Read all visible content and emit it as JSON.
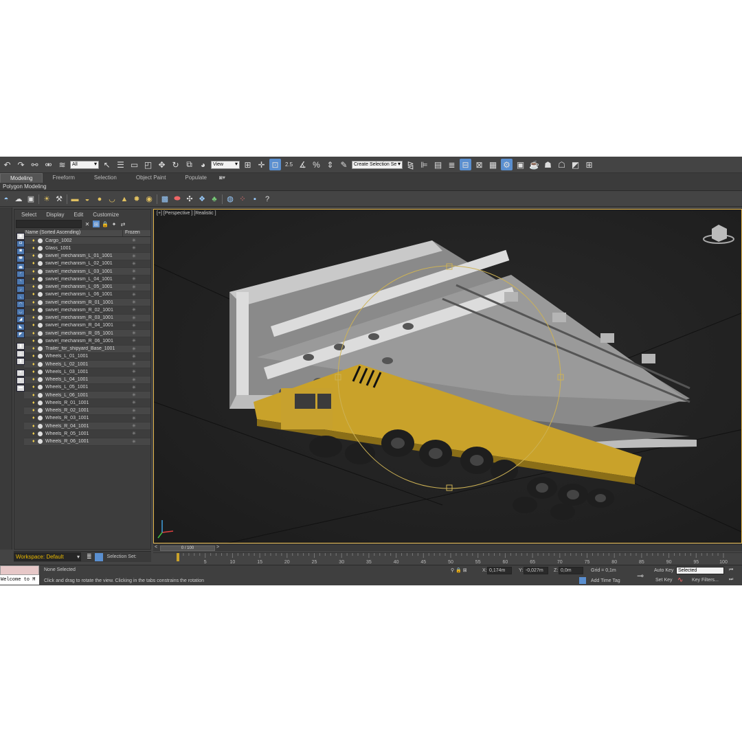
{
  "toolbar": {
    "selection_filter": "All",
    "ref_coord": "View",
    "snap_angle": "2.5",
    "named_selection": "Create Selection Se"
  },
  "ribbon": {
    "tabs": [
      "Modeling",
      "Freeform",
      "Selection",
      "Object Paint",
      "Populate"
    ],
    "active_tab": "Modeling",
    "panel": "Polygon Modeling"
  },
  "scene_explorer": {
    "menu": [
      "Select",
      "Display",
      "Edit",
      "Customize"
    ],
    "col_name": "Name (Sorted Ascending)",
    "col_frozen": "Frozen",
    "objects": [
      "Cargo_1002",
      "Glass_1001",
      "swivel_mechanism_L_01_1001",
      "swivel_mechanism_L_02_1001",
      "swivel_mechanism_L_03_1001",
      "swivel_mechanism_L_04_1001",
      "swivel_mechanism_L_05_1001",
      "swivel_mechanism_L_06_1001",
      "swivel_mechanism_R_01_1001",
      "swivel_mechanism_R_02_1001",
      "swivel_mechanism_R_03_1001",
      "swivel_mechanism_R_04_1001",
      "swivel_mechanism_R_05_1001",
      "swivel_mechanism_R_06_1001",
      "Trailer_for_shipyard_Base_1001",
      "Wheels_L_01_1001",
      "Wheels_L_02_1001",
      "Wheels_L_03_1001",
      "Wheels_L_04_1001",
      "Wheels_L_05_1001",
      "Wheels_L_06_1001",
      "Wheels_R_01_1001",
      "Wheels_R_02_1001",
      "Wheels_R_03_1001",
      "Wheels_R_04_1001",
      "Wheels_R_05_1001",
      "Wheels_R_06_1001"
    ]
  },
  "workspace": {
    "label": "Workspace: Default",
    "selection_sets": "Selection Set:"
  },
  "viewport": {
    "label": "[+] [Perspective ] [Realistic ]"
  },
  "timeline": {
    "position": "0 / 100",
    "ticks": [
      "5",
      "10",
      "15",
      "20",
      "25",
      "30",
      "35",
      "40",
      "45",
      "50",
      "55",
      "60",
      "65",
      "70",
      "75",
      "80",
      "85",
      "90",
      "95",
      "100"
    ]
  },
  "status": {
    "welcome": "Welcome to M",
    "selection": "None Selected",
    "prompt": "Click and drag to rotate the view.  Clicking in the tabs constrains the rotation",
    "x_label": "X:",
    "x_value": "0,174m",
    "y_label": "Y:",
    "y_value": "-0,027m",
    "z_label": "Z:",
    "z_value": "0,0m",
    "grid": "Grid = 0,1m",
    "add_time_tag": "Add Time Tag",
    "auto_key": "Auto Key",
    "set_key": "Set Key",
    "key_mode": "Selected",
    "key_filters": "Key Filters..."
  },
  "colors": {
    "accent": "#5a8fd0",
    "viewport_border": "#e4b64a",
    "trailer_yellow": "#c9a22a"
  }
}
